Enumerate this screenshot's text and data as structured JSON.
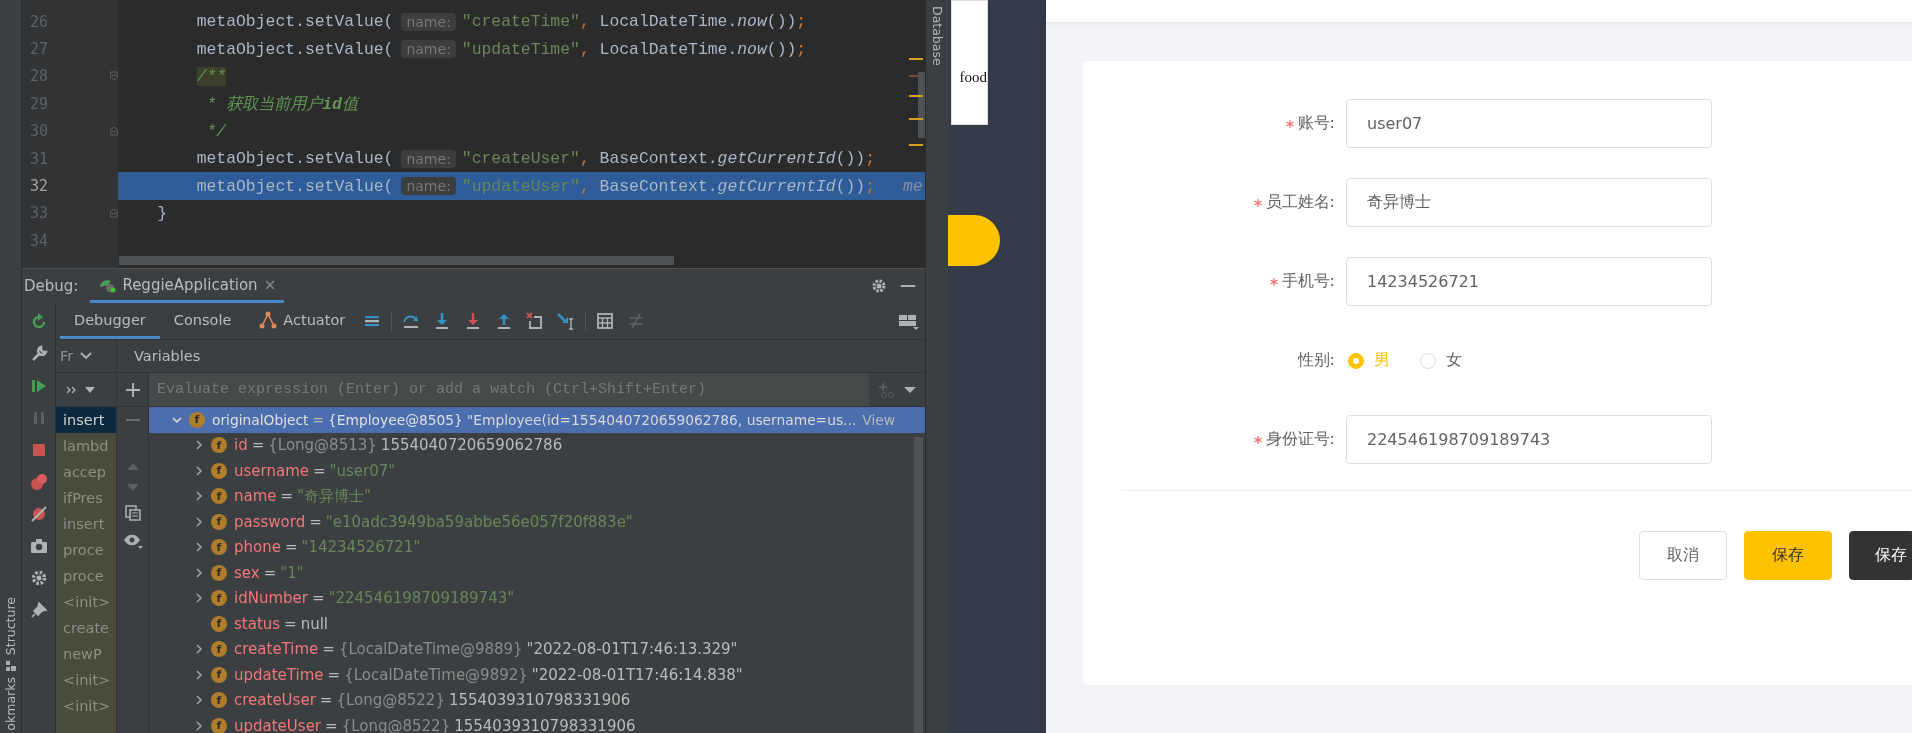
{
  "ide": {
    "editor": {
      "lines": [
        {
          "number": "26",
          "current": false,
          "kind": "statement",
          "tokens": [
            {
              "text": "metaObject.setValue(",
              "kind": "code"
            },
            {
              "text": "name:",
              "kind": "hint"
            },
            {
              "text": "\"createTime\"",
              "kind": "string"
            },
            {
              "text": ",",
              "kind": "punct"
            },
            {
              "text": " LocalDateTime.",
              "kind": "code"
            },
            {
              "text": "now",
              "kind": "italic"
            },
            {
              "text": "())",
              "kind": "code"
            },
            {
              "text": ";",
              "kind": "punct"
            }
          ]
        },
        {
          "number": "27",
          "current": false,
          "kind": "statement",
          "tokens": [
            {
              "text": "metaObject.setValue(",
              "kind": "code"
            },
            {
              "text": "name:",
              "kind": "hint"
            },
            {
              "text": "\"updateTime\"",
              "kind": "string"
            },
            {
              "text": ",",
              "kind": "punct"
            },
            {
              "text": " LocalDateTime.",
              "kind": "code"
            },
            {
              "text": "now",
              "kind": "italic"
            },
            {
              "text": "())",
              "kind": "code"
            },
            {
              "text": ";",
              "kind": "punct"
            }
          ]
        },
        {
          "number": "28",
          "current": false,
          "fold_start": true,
          "kind": "statement",
          "tokens": [
            {
              "text": "/**",
              "kind": "match"
            }
          ]
        },
        {
          "number": "29",
          "current": false,
          "kind": "doc",
          "tokens": [
            {
              "text": "* 获取当前用户**id**值",
              "kind": "comment"
            }
          ]
        },
        {
          "number": "30",
          "current": false,
          "fold_end": true,
          "kind": "doc",
          "tokens": [
            {
              "text": "*/",
              "kind": "comment"
            }
          ]
        },
        {
          "number": "31",
          "current": false,
          "kind": "statement",
          "tokens": [
            {
              "text": "metaObject.setValue(",
              "kind": "code"
            },
            {
              "text": "name:",
              "kind": "hint"
            },
            {
              "text": "\"createUser\"",
              "kind": "string"
            },
            {
              "text": ",",
              "kind": "punct"
            },
            {
              "text": " BaseContext.",
              "kind": "code"
            },
            {
              "text": "getCurrentId",
              "kind": "italic"
            },
            {
              "text": "())",
              "kind": "code"
            },
            {
              "text": ";",
              "kind": "punct"
            }
          ]
        },
        {
          "number": "32",
          "current": true,
          "kind": "statement",
          "tokens": [
            {
              "text": "metaObject.setValue(",
              "kind": "code"
            },
            {
              "text": "name:",
              "kind": "hint"
            },
            {
              "text": "\"updateUser\"",
              "kind": "string"
            },
            {
              "text": ",",
              "kind": "punct"
            },
            {
              "text": " BaseContext.",
              "kind": "code"
            },
            {
              "text": "getCurrentId",
              "kind": "italic"
            },
            {
              "text": "())",
              "kind": "code"
            },
            {
              "text": ";",
              "kind": "punct"
            },
            {
              "text": "me",
              "kind": "inline"
            }
          ]
        },
        {
          "number": "33",
          "current": false,
          "fold_end": true,
          "kind": "block_end",
          "tokens": [
            {
              "text": "}",
              "kind": "code"
            }
          ]
        },
        {
          "number": "34",
          "current": false,
          "kind": "blank"
        }
      ]
    },
    "side_labels": [
      "Structure",
      "okmarks"
    ],
    "right_tool": "Database",
    "debug": {
      "label": "Debug:",
      "session": {
        "title": "ReggieApplication",
        "close": "×",
        "selected": true
      },
      "tabs": [
        {
          "label": "Debugger",
          "selected": true
        },
        {
          "label": "Console",
          "selected": false
        },
        {
          "label": "Actuator",
          "selected": false
        }
      ],
      "frames_header": "Fr",
      "frames": [
        {
          "label": "insert",
          "selected": true
        },
        {
          "label": "lambd",
          "selected": false
        },
        {
          "label": "accep",
          "selected": false
        },
        {
          "label": "ifPres",
          "selected": false
        },
        {
          "label": "insert",
          "selected": false
        },
        {
          "label": "proce",
          "selected": false
        },
        {
          "label": "proce",
          "selected": false
        },
        {
          "label": "<init>",
          "selected": false
        },
        {
          "label": "create",
          "selected": false
        },
        {
          "label": "newP",
          "selected": false
        },
        {
          "label": "<init>",
          "selected": false
        },
        {
          "label": "<init>",
          "selected": false
        }
      ],
      "variables_header": "Variables",
      "evaluate_placeholder": "Evaluate expression (Enter) or add a watch (Ctrl+Shift+Enter)",
      "variables": [
        {
          "badge": "f",
          "name": "originalObject",
          "sign": "=",
          "type": "{Employee@8505}",
          "value": "\"Employee(id=1554040720659062786, username=us...",
          "kind": "object",
          "link": "View",
          "expandable": true,
          "expanded": true,
          "selected": true,
          "children": [
            {
              "badge": "f",
              "name": "id",
              "sign": "=",
              "type": "{Long@8513}",
              "value": "1554040720659062786",
              "kind": "plain",
              "expandable": true,
              "expanded": false,
              "selected": false
            },
            {
              "badge": "f",
              "name": "username",
              "sign": "=",
              "value": "\"user07\"",
              "kind": "string",
              "expandable": true,
              "expanded": false,
              "selected": false
            },
            {
              "badge": "f",
              "name": "name",
              "sign": "=",
              "value": "\"奇异博士\"",
              "kind": "string",
              "expandable": true,
              "expanded": false,
              "selected": false
            },
            {
              "badge": "f",
              "name": "password",
              "sign": "=",
              "value": "\"e10adc3949ba59abbe56e057f20f883e\"",
              "kind": "string",
              "expandable": true,
              "expanded": false,
              "selected": false
            },
            {
              "badge": "f",
              "name": "phone",
              "sign": "=",
              "value": "\"14234526721\"",
              "kind": "string",
              "expandable": true,
              "expanded": false,
              "selected": false
            },
            {
              "badge": "f",
              "name": "sex",
              "sign": "=",
              "value": "\"1\"",
              "kind": "string",
              "expandable": true,
              "expanded": false,
              "selected": false
            },
            {
              "badge": "f",
              "name": "idNumber",
              "sign": "=",
              "value": "\"224546198709189743\"",
              "kind": "string",
              "expandable": true,
              "expanded": false,
              "selected": false
            },
            {
              "badge": "f",
              "name": "status",
              "sign": "=",
              "value": "null",
              "kind": "plain",
              "expandable": false,
              "expanded": false,
              "selected": false
            },
            {
              "badge": "f",
              "name": "createTime",
              "sign": "=",
              "type": "{LocalDateTime@9889}",
              "value": "\"2022-08-01T17:46:13.329\"",
              "kind": "plain",
              "expandable": true,
              "expanded": false,
              "selected": false
            },
            {
              "badge": "f",
              "name": "updateTime",
              "sign": "=",
              "type": "{LocalDateTime@9892}",
              "value": "\"2022-08-01T17:46:14.838\"",
              "kind": "plain",
              "expandable": true,
              "expanded": false,
              "selected": false
            },
            {
              "badge": "f",
              "name": "createUser",
              "sign": "=",
              "type": "{Long@8522}",
              "value": "1554039310798331906",
              "kind": "plain",
              "expandable": true,
              "expanded": false,
              "selected": false
            },
            {
              "badge": "f",
              "name": "updateUser",
              "sign": "=",
              "type": "{Long@8522}",
              "value": "1554039310798331906",
              "kind": "plain",
              "expandable": true,
              "expanded": false,
              "selected": false
            }
          ]
        }
      ]
    }
  },
  "background_window": {
    "logo_text": "food"
  },
  "form": {
    "fields": [
      {
        "kind": "input",
        "label": "账号:",
        "required": true,
        "value": "user07"
      },
      {
        "kind": "input",
        "label": "员工姓名:",
        "required": true,
        "value": "奇异博士"
      },
      {
        "kind": "input",
        "label": "手机号:",
        "required": true,
        "value": "14234526721"
      },
      {
        "kind": "radio",
        "label": "性别:",
        "required": false,
        "options": [
          {
            "label": "男",
            "selected": true
          },
          {
            "label": "女",
            "selected": false
          }
        ]
      },
      {
        "kind": "input",
        "label": "身份证号:",
        "required": true,
        "value": "224546198709189743"
      }
    ],
    "buttons": [
      {
        "label": "取消",
        "kind": "default"
      },
      {
        "label": "保存",
        "kind": "primary"
      },
      {
        "label": "保存",
        "kind": "dark"
      }
    ]
  }
}
